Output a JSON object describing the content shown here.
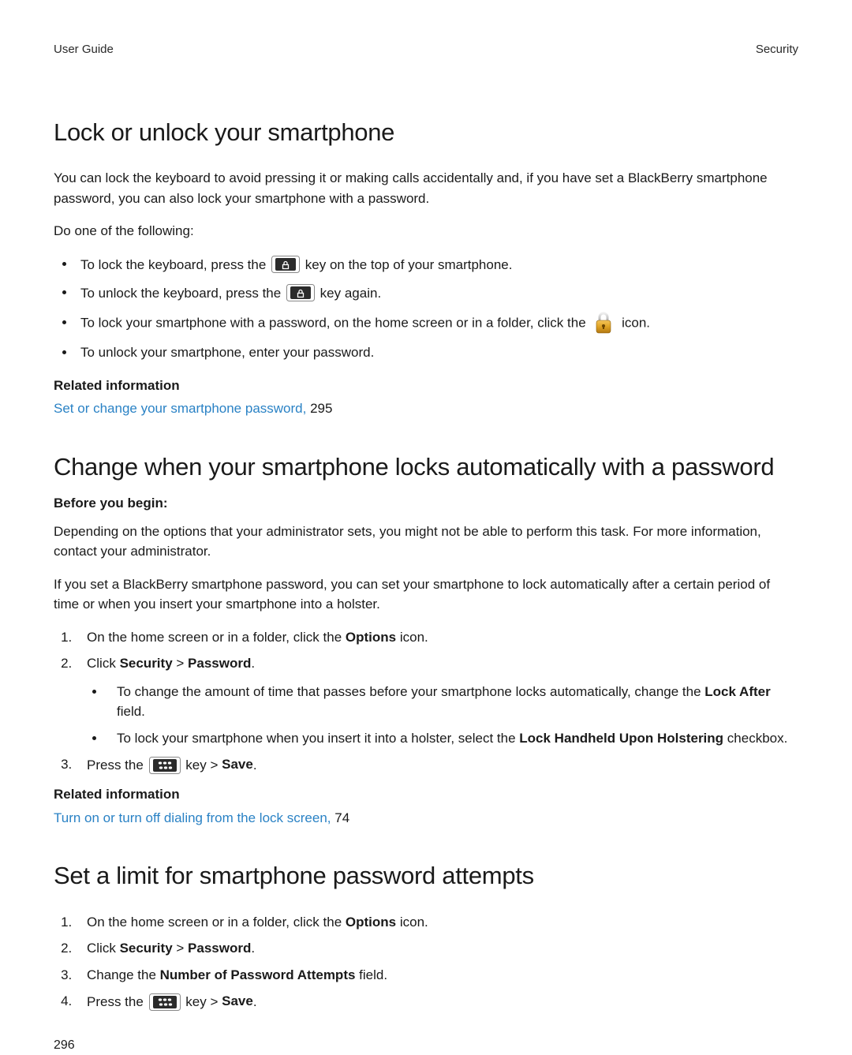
{
  "header": {
    "left": "User Guide",
    "right": "Security"
  },
  "section1": {
    "title": "Lock or unlock your smartphone",
    "intro": "You can lock the keyboard to avoid pressing it or making calls accidentally and, if you have set a BlackBerry smartphone password, you can also lock your smartphone with a password.",
    "do_label": "Do one of the following:",
    "items": {
      "1a": "To lock the keyboard, press the ",
      "1b": " key on the top of your smartphone.",
      "2a": "To unlock the keyboard, press the ",
      "2b": " key again.",
      "3a": "To lock your smartphone with a password, on the home screen or in a folder, click the ",
      "3b": " icon.",
      "4": "To unlock your smartphone, enter your password."
    },
    "related_heading": "Related information",
    "related_link": "Set or change your smartphone password,",
    "related_page": " 295"
  },
  "section2": {
    "title": "Change when your smartphone locks automatically with a password",
    "before_heading": "Before you begin:",
    "para1": "Depending on the options that your administrator sets, you might not be able to perform this task. For more information, contact your administrator.",
    "para2": "If you set a BlackBerry smartphone password, you can set your smartphone to lock automatically after a certain period of time or when you insert your smartphone into a holster.",
    "step1a": "On the home screen or in a folder, click the ",
    "step1_bold": "Options",
    "step1b": " icon.",
    "step2a": "Click ",
    "step2_bold1": "Security",
    "step2_sep": " > ",
    "step2_bold2": "Password",
    "step2b": ".",
    "sub1a": "To change the amount of time that passes before your smartphone locks automatically, change the ",
    "sub1_bold": "Lock After",
    "sub1b": " field.",
    "sub2a": "To lock your smartphone when you insert it into a holster, select the ",
    "sub2_bold": "Lock Handheld Upon Holstering",
    "sub2b": " checkbox.",
    "step3a": "Press the ",
    "step3b": " key > ",
    "step3_bold": "Save",
    "step3c": ".",
    "related_heading": "Related information",
    "related_link": "Turn on or turn off dialing from the lock screen,",
    "related_page": " 74"
  },
  "section3": {
    "title": "Set a limit for smartphone password attempts",
    "step1a": "On the home screen or in a folder, click the ",
    "step1_bold": "Options",
    "step1b": " icon.",
    "step2a": "Click ",
    "step2_bold1": "Security",
    "step2_sep": " > ",
    "step2_bold2": "Password",
    "step2b": ".",
    "step3a": "Change the ",
    "step3_bold": "Number of Password Attempts",
    "step3b": " field.",
    "step4a": "Press the ",
    "step4b": " key > ",
    "step4_bold": "Save",
    "step4c": "."
  },
  "page_number": "296"
}
